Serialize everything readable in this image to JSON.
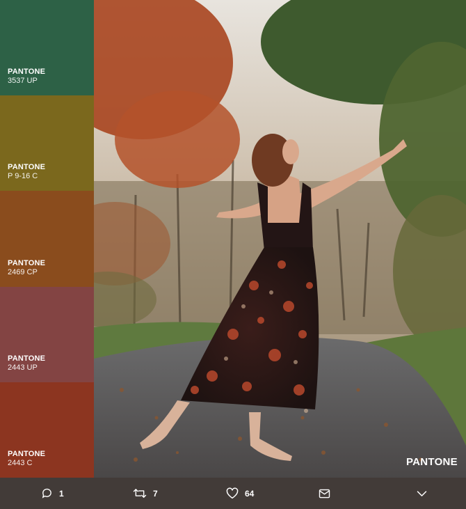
{
  "swatches": [
    {
      "brand": "PANTONE",
      "code": "3537 UP",
      "color": "#2d6146"
    },
    {
      "brand": "PANTONE",
      "code": "P 9-16 C",
      "color": "#7b681d"
    },
    {
      "brand": "PANTONE",
      "code": "2469 CP",
      "color": "#8a4c1d"
    },
    {
      "brand": "PANTONE",
      "code": "2443 UP",
      "color": "#834443"
    },
    {
      "brand": "PANTONE",
      "code": "2443 C",
      "color": "#8c3520"
    }
  ],
  "photo": {
    "logo": "PANTONE"
  },
  "actions": {
    "reply": {
      "icon": "reply-icon",
      "count": "1"
    },
    "retweet": {
      "icon": "retweet-icon",
      "count": "7"
    },
    "like": {
      "icon": "heart-icon",
      "count": "64"
    },
    "message": {
      "icon": "envelope-icon"
    },
    "more": {
      "icon": "chevron-down-icon"
    }
  }
}
